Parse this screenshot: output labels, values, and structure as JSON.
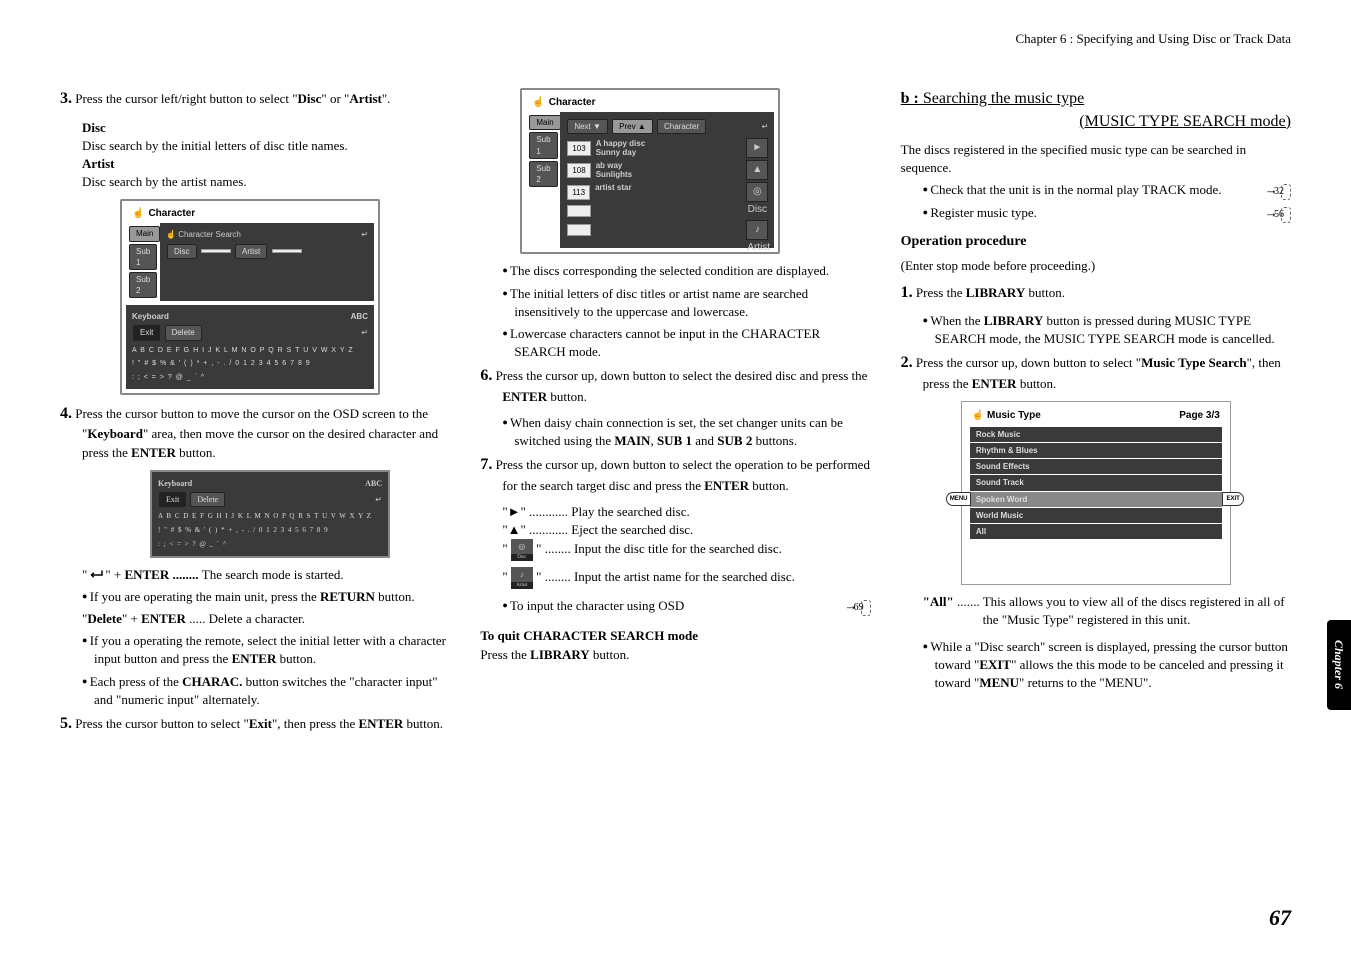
{
  "header": {
    "chapter": "Chapter 6 : Specifying and Using Disc or Track Data"
  },
  "col1": {
    "s3": {
      "num": "3.",
      "text_a": "Press the cursor left/right button to select \"",
      "disc": "Disc",
      "text_b": "\" or \"",
      "artist": "Artist",
      "text_c": "\"."
    },
    "disc_h": "Disc",
    "disc_t": "Disc search by the initial letters of disc title names.",
    "artist_h": "Artist",
    "artist_t": "Disc search by the artist names.",
    "diag1": {
      "title": "Character",
      "tabs": [
        "Main",
        "Sub 1",
        "Sub 2"
      ],
      "search_lbl": "Character Search",
      "disc_btn": "Disc",
      "artist_btn": "Artist",
      "keyboard_lbl": "Keyboard",
      "abc": "ABC",
      "exit_btn": "Exit",
      "delete_btn": "Delete",
      "row1": "A B C D E F G H I J K L M N O P Q R S T U V W X Y Z",
      "row2": "! \" # $ % & ' ( ) * + , - . / 0 1 2 3 4 5 6 7 8 9",
      "row3": ": ; < = > ? @ _ ` ^"
    },
    "s4": {
      "num": "4.",
      "text_a": "Press the cursor button to move the cursor on the OSD screen to the \"",
      "keyboard": "Keyboard",
      "text_b": "\" area, then move the cursor on the desired character and press the ",
      "enter": "ENTER",
      "text_c": " button."
    },
    "diag2": {
      "keyboard_lbl": "Keyboard",
      "abc": "ABC",
      "exit_btn": "Exit",
      "delete_btn": "Delete",
      "row1": "A B C D E F G H I J K L M N O P Q R S T U V W X Y Z",
      "row2": "! \" # $ % & ' ( ) * + , - . / 0 1 2 3 4 5 6 7 8 9",
      "row3": ": ; < = > ? @ _ ` ^"
    },
    "ret_enter_a": "\" + ",
    "ret_enter_b": "ENTER",
    "ret_enter_c": " ........ ",
    "ret_enter_d": "The search mode is started.",
    "b1_a": "If you are operating the main unit, press the ",
    "b1_b": "RETURN",
    "b1_c": " button.",
    "del_a": "\"",
    "del_b": "Delete",
    "del_c": "\" + ",
    "del_d": "ENTER",
    "del_e": " ..... Delete a character.",
    "b2_a": "If you a operating the remote, select the initial letter with a character input button and press the ",
    "b2_b": "ENTER",
    "b2_c": " button.",
    "b3_a": "Each press of the ",
    "b3_b": "CHARAC.",
    "b3_c": " button switches the \"character input\" and \"numeric input\" alternately.",
    "s5": {
      "num": "5.",
      "text_a": "Press the cursor button to select \"",
      "exit": "Exit",
      "text_b": "\", then press the ",
      "enter": "ENTER",
      "text_c": " button."
    }
  },
  "col2": {
    "diag3": {
      "title": "Character",
      "tabs": [
        "Main",
        "Sub 1",
        "Sub 2"
      ],
      "next": "Next ▼",
      "prev": "Prev ▲",
      "charbtn": "Character",
      "rows": [
        {
          "num": "103",
          "line1": "A happy disc",
          "line2": "Sunny day"
        },
        {
          "num": "108",
          "line1": "ab way",
          "line2": "Sunlights"
        },
        {
          "num": "113",
          "line1": "artist star",
          "line2": ""
        }
      ],
      "icons": {
        "play": "►",
        "eject": "▲",
        "disc": "◎",
        "artist": "♪"
      },
      "disc_lbl": "Disc",
      "artist_lbl": "Artist"
    },
    "b1": "The discs corresponding the selected condition are displayed.",
    "b2": "The initial letters of disc titles or artist name are searched insensitively to the uppercase and lowercase.",
    "b3": "Lowercase characters cannot be input in the CHARACTER SEARCH mode.",
    "s6": {
      "num": "6.",
      "text_a": "Press the cursor up, down button to select the desired disc and press the ",
      "enter": "ENTER",
      "text_b": " button."
    },
    "b4_a": "When daisy chain connection is set, the set changer units can be switched using the ",
    "b4_b": "MAIN",
    "b4_c": ", ",
    "b4_d": "SUB 1",
    "b4_e": " and ",
    "b4_f": "SUB 2",
    "b4_g": " buttons.",
    "s7": {
      "num": "7.",
      "text_a": "Press the cursor up, down button to select the operation to be performed for the search target disc and press the ",
      "enter": "ENTER",
      "text_b": " button."
    },
    "play": "\"►\" ............ Play the searched disc.",
    "eject": "\"▲\" ............ Eject the searched disc.",
    "disc_a": "\" ",
    "disc_b": " \" ........ Input the disc title for the searched disc.",
    "artist_a": "\" ",
    "artist_b": " \" ........ Input the artist name for the searched disc.",
    "input_osd_a": "To input the character using OSD",
    "input_osd_ref": "69",
    "quit_h": "To quit CHARACTER SEARCH mode",
    "quit_t_a": "Press the ",
    "quit_t_b": "LIBRARY",
    "quit_t_c": " button."
  },
  "col3": {
    "h_b": "b : ",
    "h_t1": "Searching the music type",
    "h_t2": "(MUSIC TYPE SEARCH mode)",
    "intro": "The discs registered in the specified music type can be searched in sequence.",
    "b1": "Check that the unit is in the normal play TRACK mode.",
    "b1_ref": "32",
    "b2": "Register music type.",
    "b2_ref": "56",
    "op": "Operation procedure",
    "enter_stop": "(Enter stop mode before proceeding.)",
    "s1": {
      "num": "1.",
      "text_a": "Press the ",
      "lib": "LIBRARY",
      "text_b": " button."
    },
    "b3_a": "When the ",
    "b3_b": "LIBRARY",
    "b3_c": " button is pressed during MUSIC TYPE SEARCH mode, the MUSIC TYPE SEARCH mode is cancelled.",
    "s2": {
      "num": "2.",
      "text_a": "Press the cursor up, down button to select \"",
      "mts": "Music Type Search",
      "text_b": "\", then press the ",
      "enter": "ENTER",
      "text_c": " button."
    },
    "musicbox": {
      "title": "Music Type",
      "page": "Page 3/3",
      "menu": "MENU",
      "exit": "EXIT",
      "items": [
        "Rock Music",
        "Rhythm & Blues",
        "Sound Effects",
        "Sound Track",
        "Spoken Word",
        "World Music",
        "All"
      ]
    },
    "all_h": "\"All\"",
    "all_t": " ....... This allows you to view all of the discs registered in all of the \"Music Type\" registered in this unit.",
    "b4_a": "While a \"Disc search\" screen is displayed, pressing the cursor button toward \"",
    "b4_b": "EXIT",
    "b4_c": "\" allows the this mode to be canceled and pressing it toward \"",
    "b4_d": "MENU",
    "b4_e": "\" returns to the \"MENU\"."
  },
  "side": "Chapter 6",
  "page": "67"
}
